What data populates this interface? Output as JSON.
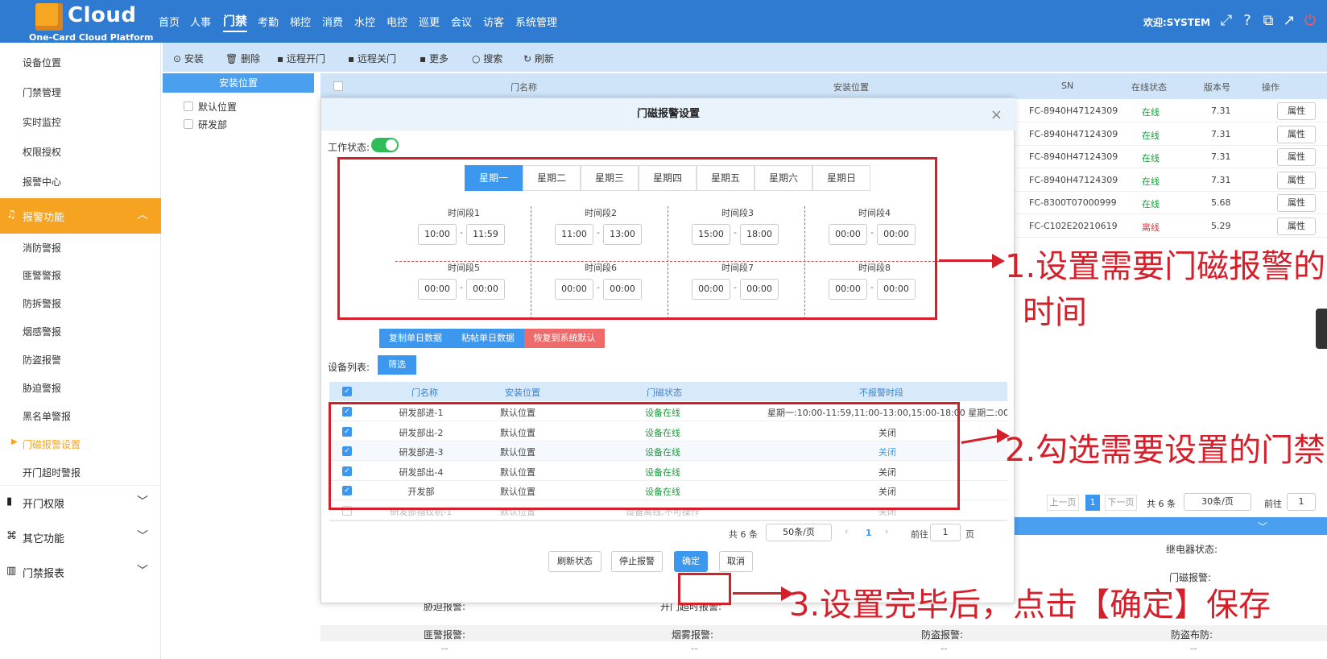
{
  "header": {
    "logo": "Cloud",
    "logo_sub": "One-Card Cloud Platform",
    "nav": [
      "首页",
      "人事",
      "门禁",
      "考勤",
      "梯控",
      "消费",
      "水控",
      "电控",
      "巡更",
      "会议",
      "访客",
      "系统管理"
    ],
    "welcome": "欢迎:SYSTEM"
  },
  "sidebar": {
    "items": [
      "设备位置",
      "门禁管理",
      "实时监控",
      "权限授权",
      "报警中心"
    ],
    "alarm": "报警功能",
    "alarm_sub": [
      "消防警报",
      "匪警警报",
      "防拆警报",
      "烟感警报",
      "防盗报警",
      "胁迫警报",
      "黑名单警报",
      "门磁报警设置",
      "开门超时警报"
    ],
    "groups": [
      "开门权限",
      "其它功能",
      "门禁报表"
    ]
  },
  "toolbar": [
    "安装",
    "删除",
    "远程开门",
    "远程关门",
    "更多",
    "搜索",
    "刷新"
  ],
  "tree": {
    "header": "安装位置",
    "items": [
      "默认位置",
      "研发部"
    ]
  },
  "main_table": {
    "columns": [
      "门名称",
      "安装位置",
      "SN",
      "在线状态",
      "版本号",
      "操作"
    ],
    "rows": [
      {
        "sn": "FC-8940H47124309",
        "status": "在线",
        "ver": "7.31",
        "op": "属性"
      },
      {
        "sn": "FC-8940H47124309",
        "status": "在线",
        "ver": "7.31",
        "op": "属性"
      },
      {
        "sn": "FC-8940H47124309",
        "status": "在线",
        "ver": "7.31",
        "op": "属性"
      },
      {
        "sn": "FC-8940H47124309",
        "status": "在线",
        "ver": "7.31",
        "op": "属性"
      },
      {
        "sn": "FC-8300T07000999",
        "status": "在线",
        "ver": "5.68",
        "op": "属性"
      },
      {
        "sn": "FC-C102E20210619",
        "status": "离线",
        "ver": "5.29",
        "op": "属性"
      }
    ],
    "pager": {
      "prev": "上一页",
      "page": "1",
      "next": "下一页",
      "total": "共 6 条",
      "size": "30条/页",
      "goto": "前往",
      "goto_val": "1",
      "suffix": "页"
    }
  },
  "detail": {
    "relay": "继电器状态:",
    "door_alarm": "门磁报警:",
    "duress": "胁迫报警:",
    "open": "开门超时报警:",
    "police": "匪警报警:",
    "smoke": "烟雾报警:",
    "theft": "防盗报警:",
    "guard": "防盗布防:",
    "empty": "--"
  },
  "modal": {
    "title": "门磁报警设置",
    "work_label": "工作状态:",
    "days": [
      "星期一",
      "星期二",
      "星期三",
      "星期四",
      "星期五",
      "星期六",
      "星期日"
    ],
    "slots": [
      {
        "label": "时间段1",
        "from": "10:00",
        "to": "11:59"
      },
      {
        "label": "时间段2",
        "from": "11:00",
        "to": "13:00"
      },
      {
        "label": "时间段3",
        "from": "15:00",
        "to": "18:00"
      },
      {
        "label": "时间段4",
        "from": "00:00",
        "to": "00:00"
      },
      {
        "label": "时间段5",
        "from": "00:00",
        "to": "00:00"
      },
      {
        "label": "时间段6",
        "from": "00:00",
        "to": "00:00"
      },
      {
        "label": "时间段7",
        "from": "00:00",
        "to": "00:00"
      },
      {
        "label": "时间段8",
        "from": "00:00",
        "to": "00:00"
      }
    ],
    "dash": "-",
    "actions": [
      "复制单日数据",
      "粘帖单日数据",
      "恢复到系统默认"
    ],
    "device_label": "设备列表:",
    "filter": "筛选",
    "columns": [
      "门名称",
      "安装位置",
      "门磁状态",
      "不报警时段"
    ],
    "rows": [
      {
        "name": "研发部进-1",
        "loc": "默认位置",
        "state": "设备在线",
        "period": "星期一:10:00-11:59,11:00-13:00,15:00-18:00 星期二:00:0"
      },
      {
        "name": "研发部出-2",
        "loc": "默认位置",
        "state": "设备在线",
        "period": "关闭"
      },
      {
        "name": "研发部进-3",
        "loc": "默认位置",
        "state": "设备在线",
        "period": "关闭"
      },
      {
        "name": "研发部出-4",
        "loc": "默认位置",
        "state": "设备在线",
        "period": "关闭"
      },
      {
        "name": "开发部",
        "loc": "默认位置",
        "state": "设备在线",
        "period": "关闭"
      },
      {
        "name": "研发部指纹机-1",
        "loc": "默认位置",
        "state": "设备离线,不可操作",
        "period": "关闭"
      }
    ],
    "pager": {
      "total": "共 6 条",
      "size": "50条/页",
      "page": "1",
      "goto": "前往",
      "goto_val": "1",
      "suffix": "页"
    },
    "footer": [
      "刷新状态",
      "停止报警",
      "确定",
      "取消"
    ]
  },
  "annotations": [
    "1.设置需要门磁报警的",
    "时间",
    "2.勾选需要设置的门禁",
    "3.设置完毕后，点击【确定】保存"
  ]
}
